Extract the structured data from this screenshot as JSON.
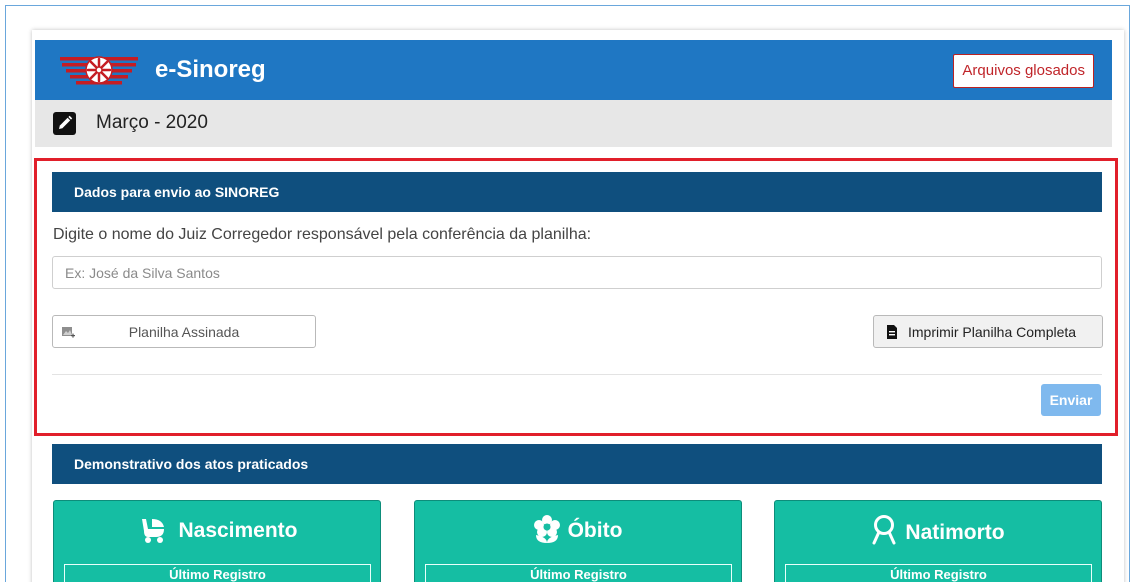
{
  "app": {
    "brand": "e-Sinoreg",
    "archived_button": "Arquivos glosados"
  },
  "period": {
    "title": "Março - 2020",
    "edit_icon": "edit-icon"
  },
  "submission": {
    "header": "Dados para envio ao SINOREG",
    "prompt": "Digite o nome do Juiz Corregedor responsável pela conferência da planilha:",
    "judge_placeholder": "Ex: José da Silva Santos",
    "judge_value": "",
    "file_label": "Planilha Assinada",
    "print_label": "Imprimir Planilha Completa",
    "send_label": "Enviar"
  },
  "demonstrativo": {
    "header": "Demonstrativo dos atos praticados",
    "tiles": [
      {
        "title": "Nascimento",
        "subtitle": "Último Registro",
        "icon": "stroller-icon"
      },
      {
        "title": "Óbito",
        "subtitle": "Último Registro",
        "icon": "flower-icon"
      },
      {
        "title": "Natimorto",
        "subtitle": "Último Registro",
        "icon": "ribbon-icon"
      }
    ]
  },
  "colors": {
    "topbar": "#1f77c3",
    "section": "#0f4f7e",
    "tile": "#15bea3",
    "highlight": "#e11f2a",
    "send": "#7fb9ee"
  }
}
